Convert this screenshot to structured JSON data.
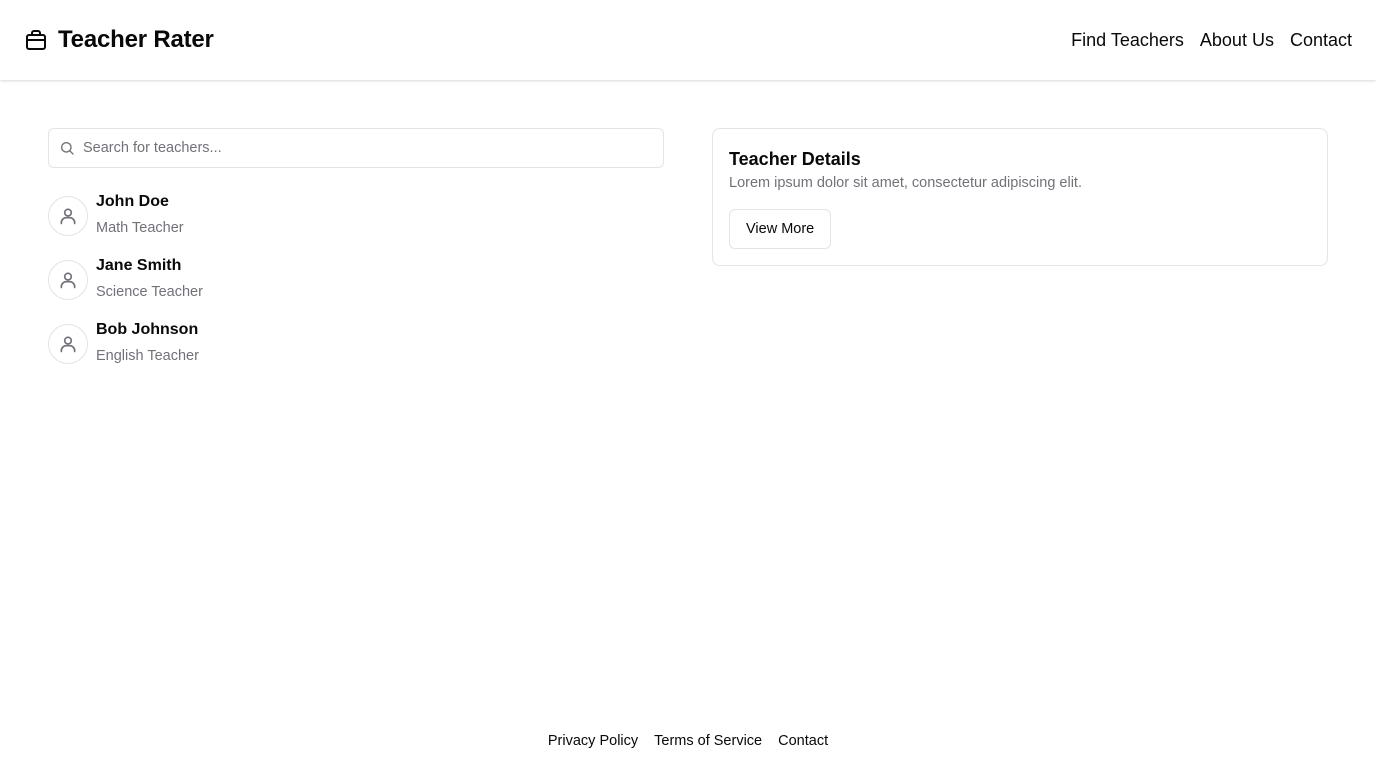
{
  "header": {
    "brand_icon": "briefcase-icon",
    "title": "Teacher Rater",
    "nav": [
      "Find Teachers",
      "About Us",
      "Contact"
    ]
  },
  "search": {
    "icon": "search-icon",
    "placeholder": "Search for teachers..."
  },
  "teachers": [
    {
      "name": "John Doe",
      "subject": "Math Teacher",
      "avatar_icon": "user-icon"
    },
    {
      "name": "Jane Smith",
      "subject": "Science Teacher",
      "avatar_icon": "user-icon"
    },
    {
      "name": "Bob Johnson",
      "subject": "English Teacher",
      "avatar_icon": "user-icon"
    }
  ],
  "details": {
    "title": "Teacher Details",
    "description": "Lorem ipsum dolor sit amet, consectetur adipiscing elit.",
    "button_label": "View More"
  },
  "footer": {
    "links": [
      "Privacy Policy",
      "Terms of Service",
      "Contact"
    ]
  },
  "colors": {
    "text": "#09090b",
    "muted": "#71717a",
    "border": "#e4e4e7",
    "background": "#ffffff"
  }
}
